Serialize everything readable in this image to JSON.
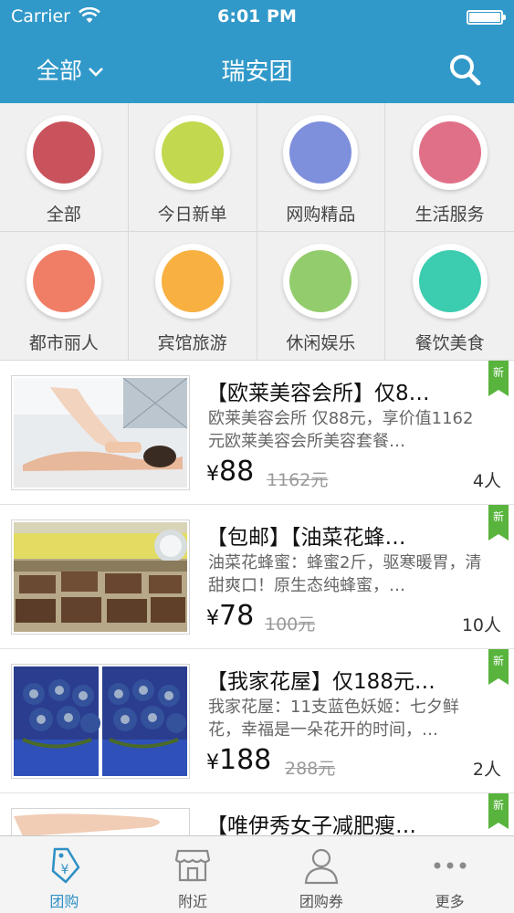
{
  "status_bar": {
    "carrier": "Carrier",
    "time": "6:01 PM"
  },
  "nav": {
    "left_label": "全部",
    "title": "瑞安团"
  },
  "categories": [
    {
      "label": "全部",
      "color": "#c9535c"
    },
    {
      "label": "今日新单",
      "color": "#c2d84e"
    },
    {
      "label": "网购精品",
      "color": "#7e8fdc"
    },
    {
      "label": "生活服务",
      "color": "#e07088"
    },
    {
      "label": "都市丽人",
      "color": "#f07e66"
    },
    {
      "label": "宾馆旅游",
      "color": "#f8b040"
    },
    {
      "label": "休闲娱乐",
      "color": "#93cc6c"
    },
    {
      "label": "餐饮美食",
      "color": "#3cccb0"
    }
  ],
  "deals": [
    {
      "title": "【欧莱美容会所】仅8…",
      "desc": "欧莱美容会所 仅88元，享价值1162元欧莱美容会所美容套餐…",
      "yen": "¥",
      "price": "88",
      "orig": "1162元",
      "sold": "4人",
      "badge": "新"
    },
    {
      "title": "【包邮】【油菜花蜂…",
      "desc": "油菜花蜂蜜：蜂蜜2斤，驱寒暖胃，清甜爽口！原生态纯蜂蜜，…",
      "yen": "¥",
      "price": "78",
      "orig": "100元",
      "sold": "10人",
      "badge": "新"
    },
    {
      "title": "【我家花屋】仅188元…",
      "desc": "我家花屋：11支蓝色妖姬：七夕鲜花，幸福是一朵花开的时间，…",
      "yen": "¥",
      "price": "188",
      "orig": "288元",
      "sold": "2人",
      "badge": "新"
    },
    {
      "title": "【唯伊秀女子减肥瘦…",
      "desc": "",
      "yen": "",
      "price": "",
      "orig": "",
      "sold": "",
      "badge": "新"
    }
  ],
  "tabs": [
    {
      "label": "团购",
      "icon": "price-tag-icon"
    },
    {
      "label": "附近",
      "icon": "storefront-icon"
    },
    {
      "label": "团购券",
      "icon": "person-icon"
    },
    {
      "label": "更多",
      "icon": "more-dots-icon"
    }
  ],
  "colors": {
    "accent": "#3199c9",
    "tab_active": "#2f90c5",
    "new_badge": "#58b43c"
  }
}
